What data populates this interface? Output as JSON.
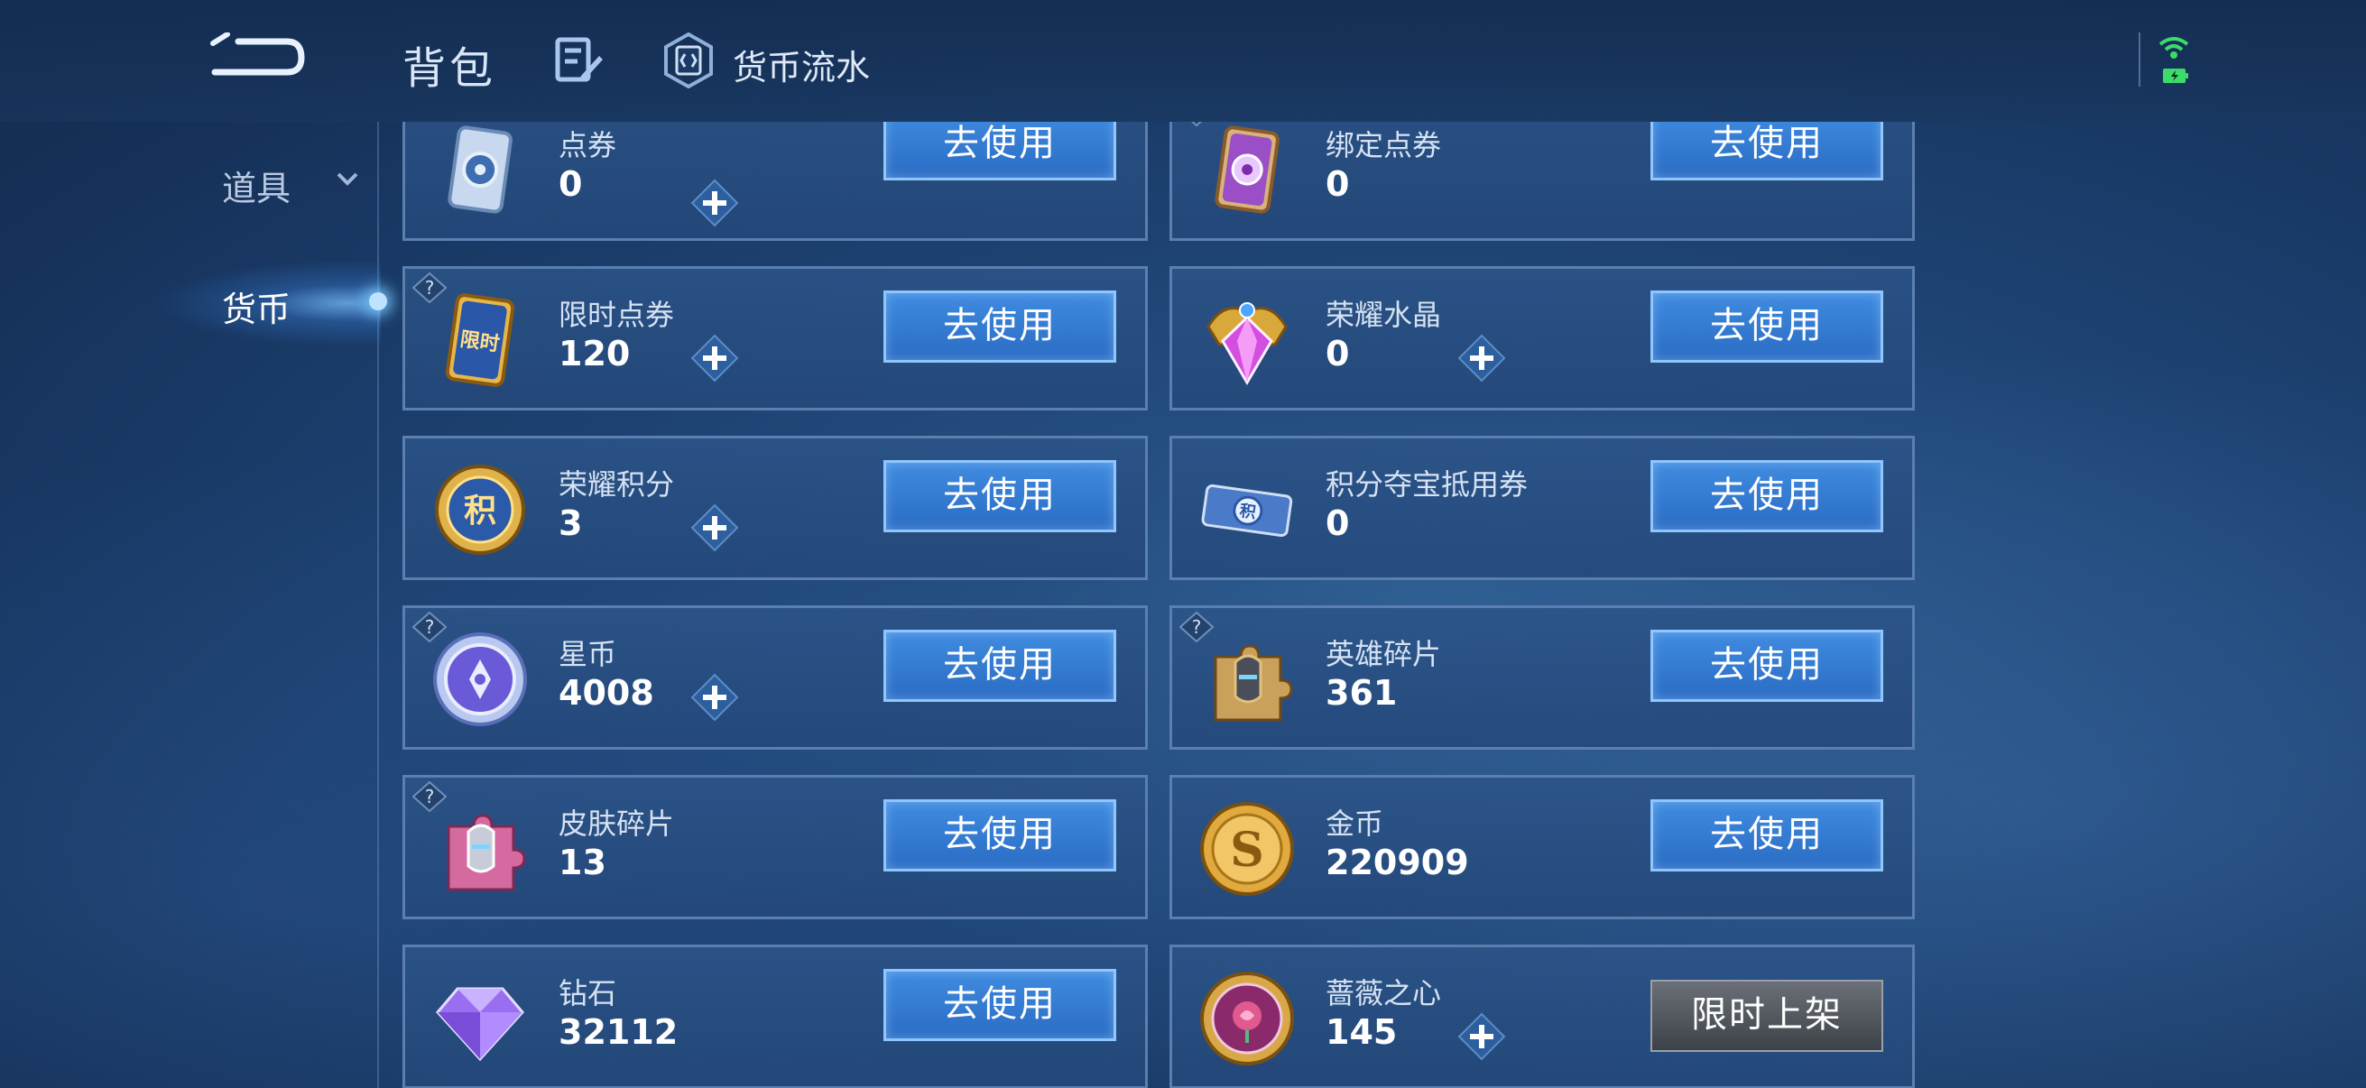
{
  "header": {
    "title": "背包",
    "flow_label": "货币流水"
  },
  "sidebar": {
    "items": [
      {
        "label": "道具"
      },
      {
        "label": "货币"
      }
    ]
  },
  "cards": [
    {
      "name": "点券",
      "value": "0",
      "button": "去使用"
    },
    {
      "name": "绑定点券",
      "value": "0",
      "button": "去使用"
    },
    {
      "name": "限时点券",
      "value": "120",
      "button": "去使用"
    },
    {
      "name": "荣耀水晶",
      "value": "0",
      "button": "去使用"
    },
    {
      "name": "荣耀积分",
      "value": "3",
      "button": "去使用"
    },
    {
      "name": "积分夺宝抵用券",
      "value": "0",
      "button": "去使用"
    },
    {
      "name": "星币",
      "value": "4008",
      "button": "去使用"
    },
    {
      "name": "英雄碎片",
      "value": "361",
      "button": "去使用"
    },
    {
      "name": "皮肤碎片",
      "value": "13",
      "button": "去使用"
    },
    {
      "name": "金币",
      "value": "220909",
      "button": "去使用"
    },
    {
      "name": "钻石",
      "value": "32112",
      "button": "去使用"
    },
    {
      "name": "蔷薇之心",
      "value": "145",
      "button": "限时上架"
    }
  ],
  "icon_glyphs": {
    "limited_ticket": "限时",
    "honor_points": "积",
    "coupon": "积",
    "gold": "S"
  },
  "colors": {
    "accent_button": "#2f78d4",
    "button_border": "#8fc6ff",
    "card_border": "#5a7fb0",
    "background": "#1d4272"
  }
}
